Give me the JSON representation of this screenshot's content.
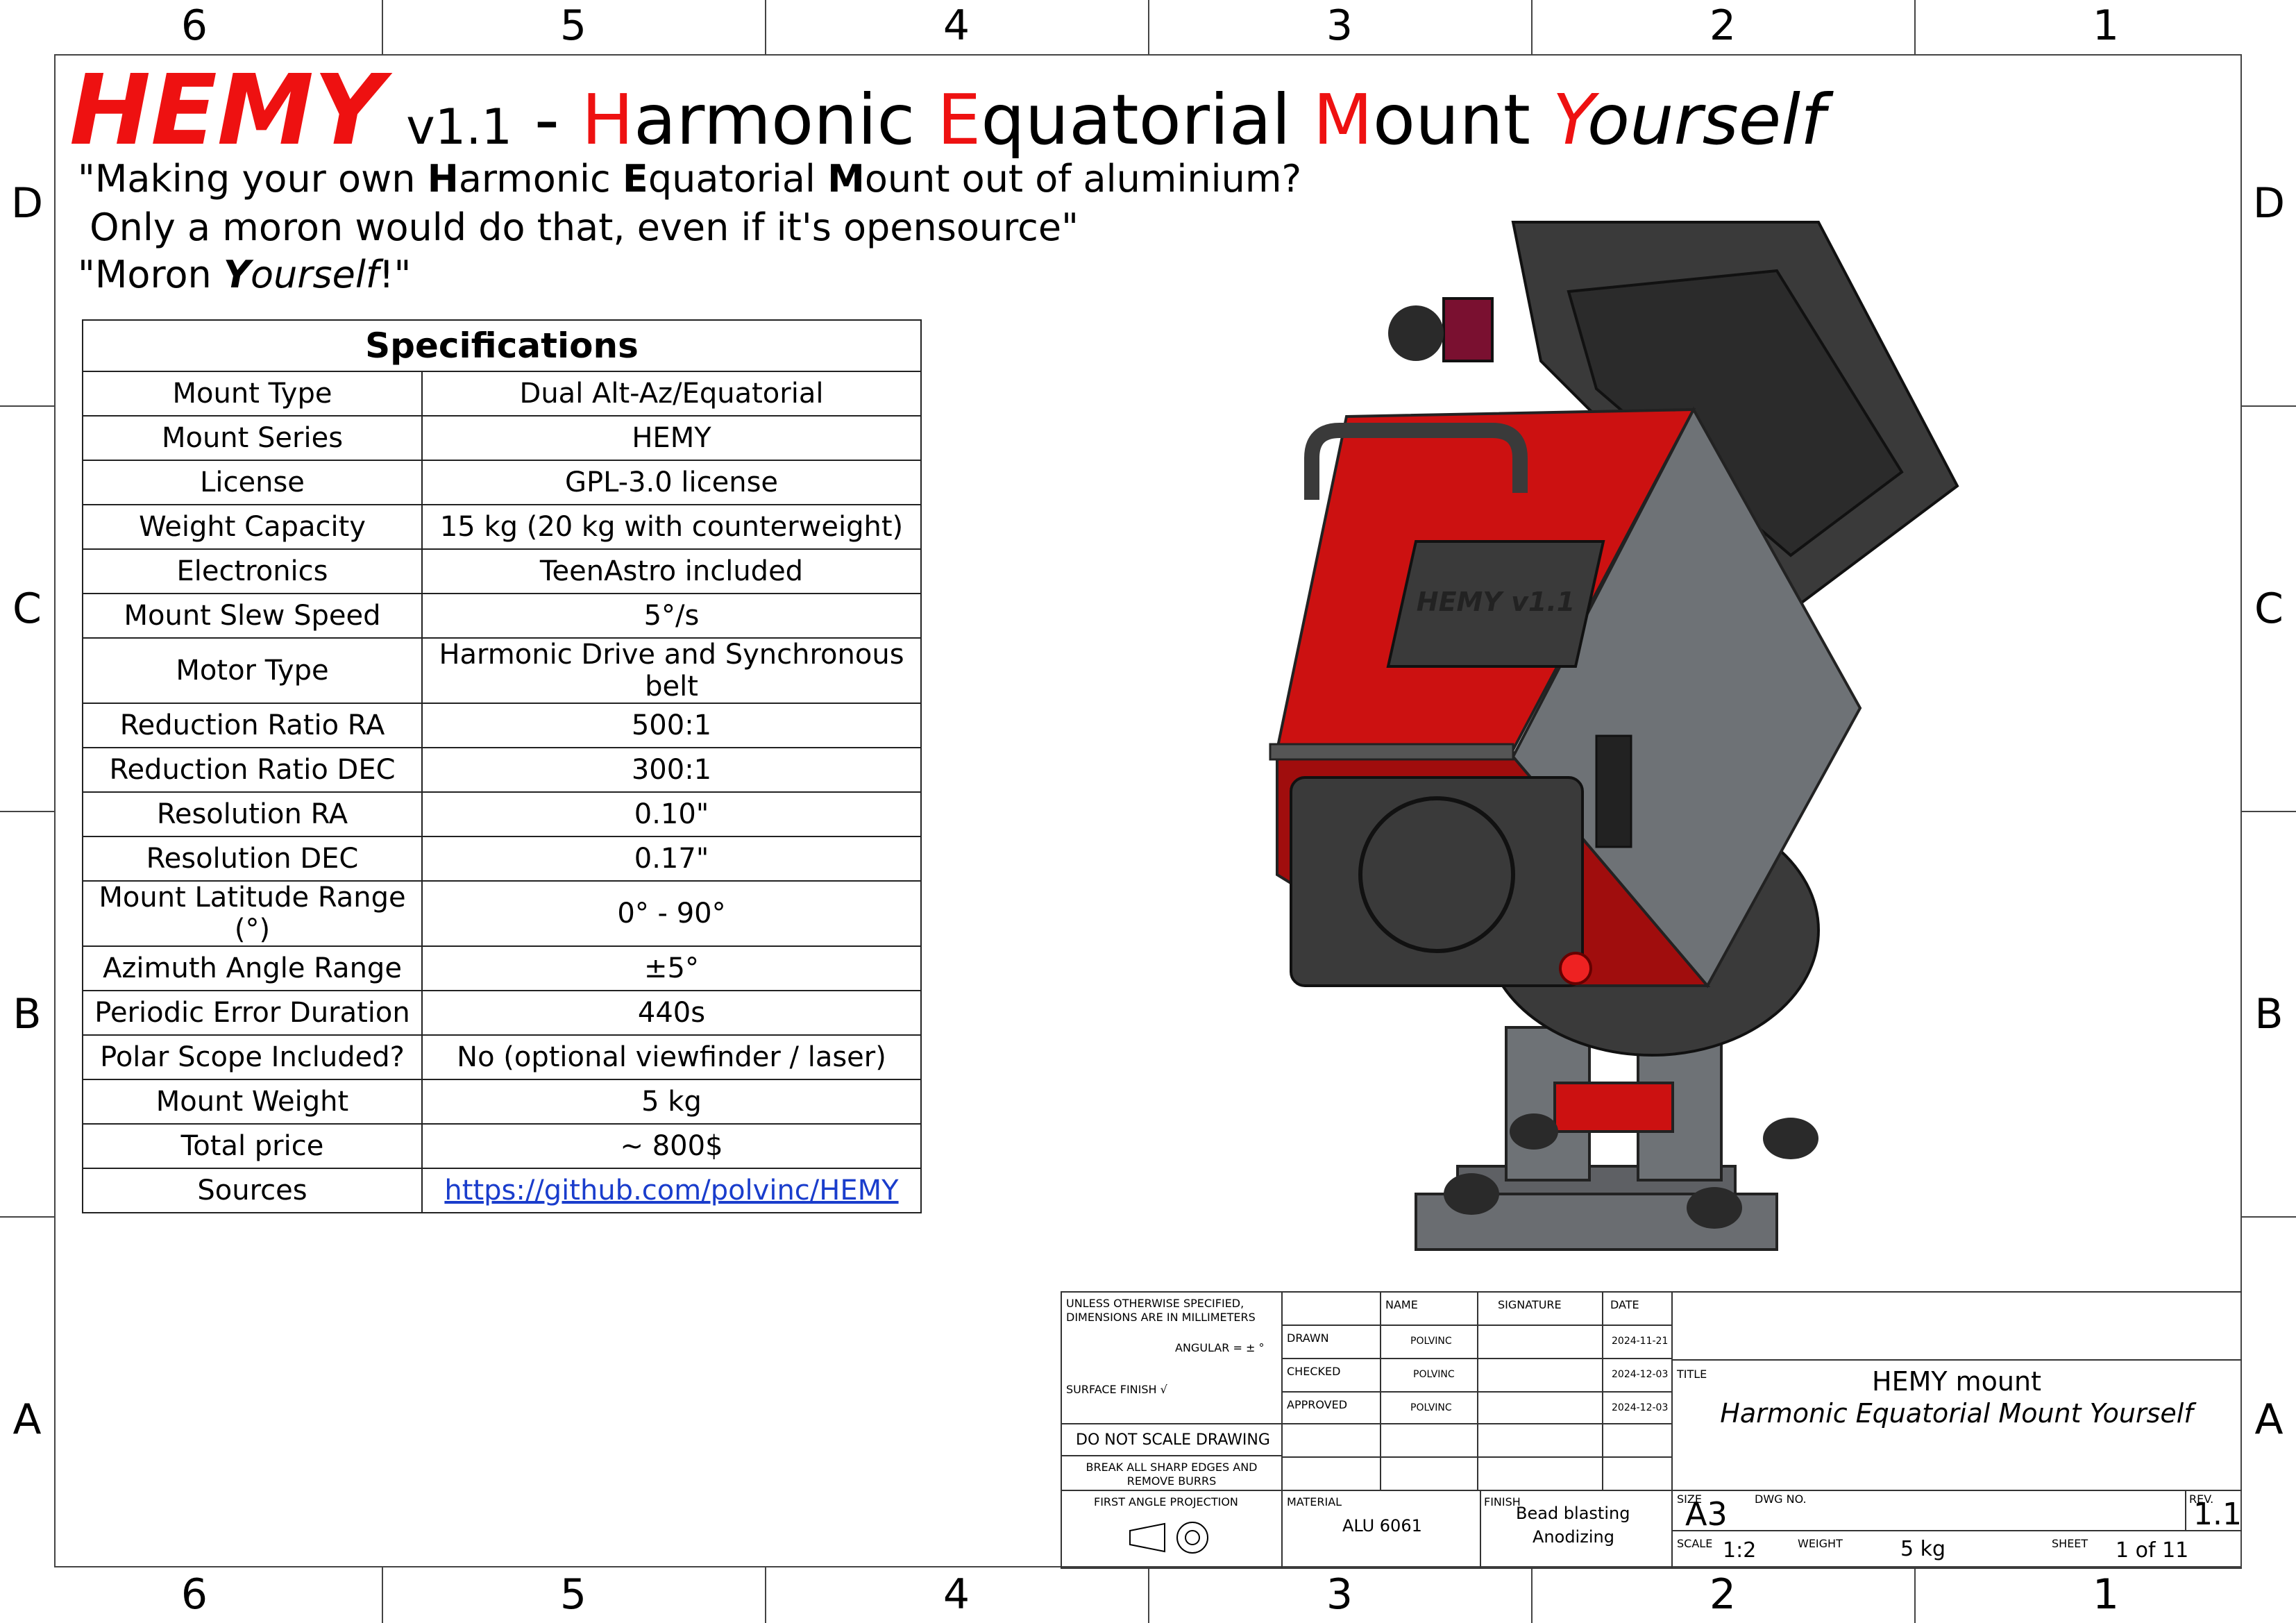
{
  "zones": {
    "columns": [
      "6",
      "5",
      "4",
      "3",
      "2",
      "1"
    ],
    "rows": [
      "D",
      "C",
      "B",
      "A"
    ]
  },
  "header": {
    "brand": "HEMY",
    "version": "v1.1",
    "dash": "-",
    "h": "H",
    "armonic": "armonic",
    "e": "E",
    "quatorial": "quatorial",
    "m": "M",
    "ount": "ount",
    "y": "Y",
    "ourself": "ourself"
  },
  "quote": {
    "l1a": "\"Making your own ",
    "l1H": "H",
    "l1b": "armonic ",
    "l1E": "E",
    "l1c": "quatorial ",
    "l1M": "M",
    "l1d": "ount out of aluminium?",
    "l2": " Only a moron would do that, even if it's opensource\"",
    "l3a": "\"Moron ",
    "l3Y": "Y",
    "l3b": "ourself",
    "l3c": "!\""
  },
  "specs": {
    "title": "Specifications",
    "rows": [
      {
        "k": "Mount Type",
        "v": "Dual Alt-Az/Equatorial"
      },
      {
        "k": "Mount Series",
        "v": "HEMY"
      },
      {
        "k": "License",
        "v": "GPL-3.0 license"
      },
      {
        "k": "Weight Capacity",
        "v": "15 kg (20 kg with counterweight)"
      },
      {
        "k": "Electronics",
        "v": "TeenAstro included"
      },
      {
        "k": "Mount Slew Speed",
        "v": "5°/s"
      },
      {
        "k": "Motor Type",
        "v": "Harmonic Drive and Synchronous belt"
      },
      {
        "k": "Reduction Ratio RA",
        "v": "500:1"
      },
      {
        "k": "Reduction Ratio DEC",
        "v": "300:1"
      },
      {
        "k": "Resolution RA",
        "v": "0.10\""
      },
      {
        "k": "Resolution DEC",
        "v": "0.17\""
      },
      {
        "k": "Mount Latitude Range (°)",
        "v": "0° - 90°"
      },
      {
        "k": "Azimuth Angle Range",
        "v": "±5°"
      },
      {
        "k": "Periodic Error Duration",
        "v": "440s"
      },
      {
        "k": "Polar Scope Included?",
        "v": "No (optional viewfinder / laser)"
      },
      {
        "k": "Mount Weight",
        "v": "5 kg"
      },
      {
        "k": "Total price",
        "v": "~ 800$"
      },
      {
        "k": "Sources",
        "v": "https://github.com/polvinc/HEMY"
      }
    ]
  },
  "render": {
    "plate_text": "HEMY v1.1",
    "colors": {
      "body": "#cc1111",
      "dark": "#3a3a3a",
      "grey": "#6e7276"
    }
  },
  "titleblock": {
    "unless": "UNLESS OTHERWISE SPECIFIED, DIMENSIONS ARE IN MILLIMETERS",
    "angular": "ANGULAR = ± °",
    "surface": "SURFACE FINISH",
    "noscale": "DO NOT SCALE DRAWING",
    "burrs": "BREAK ALL SHARP EDGES AND REMOVE BURRS",
    "projection": "FIRST ANGLE PROJECTION",
    "name_h": "NAME",
    "sig_h": "SIGNATURE",
    "date_h": "DATE",
    "drawn": "DRAWN",
    "checked": "CHECKED",
    "approved": "APPROVED",
    "drawn_name": "POLVINC",
    "checked_name": "POLVINC",
    "approved_name": "POLVINC",
    "drawn_date": "2024-11-21",
    "checked_date": "2024-12-03",
    "approved_date": "2024-12-03",
    "title_lbl": "TITLE",
    "title1": "HEMY mount",
    "title2": "Harmonic Equatorial Mount Yourself",
    "material_lbl": "MATERIAL",
    "material": "ALU 6061",
    "finish_lbl": "FINISH",
    "finish1": "Bead blasting",
    "finish2": "Anodizing",
    "size_lbl": "SIZE",
    "size": "A3",
    "dwg_lbl": "DWG NO.",
    "rev_lbl": "REV.",
    "rev": "1.1",
    "scale_lbl": "SCALE",
    "scale": "1:2",
    "weight_lbl": "WEIGHT",
    "weight": "5 kg",
    "sheet_lbl": "SHEET",
    "sheet": "1 of 11"
  }
}
